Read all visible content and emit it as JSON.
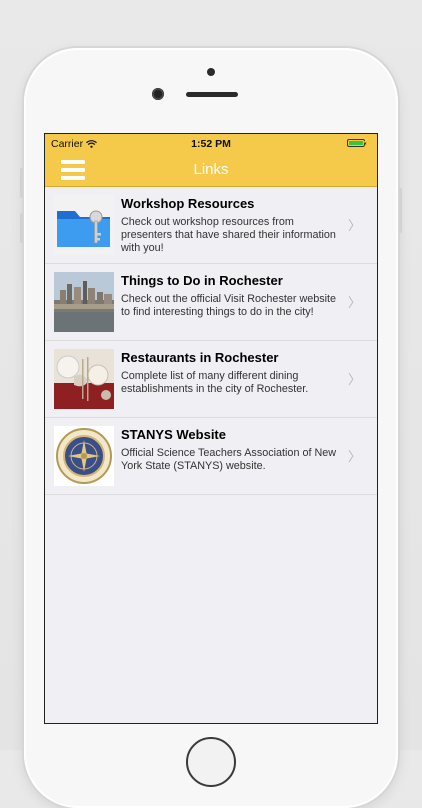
{
  "status_bar": {
    "carrier": "Carrier",
    "time": "1:52 PM",
    "battery_color": "#3bc43b"
  },
  "nav": {
    "title": "Links",
    "menu_icon": "hamburger-menu-icon",
    "bar_color": "#f5c94a"
  },
  "links": [
    {
      "title": "Workshop Resources",
      "description": "Check out workshop resources from presenters that have shared their information with you!",
      "thumbnail": "folder-key-icon"
    },
    {
      "title": "Things to Do in Rochester",
      "description": "Check out the official Visit Rochester website to find interesting things to do in the city!",
      "thumbnail": "rochester-skyline-photo"
    },
    {
      "title": "Restaurants in Rochester",
      "description": "Complete list of many different dining establishments in the city of Rochester.",
      "thumbnail": "dining-table-photo"
    },
    {
      "title": "STANYS Website",
      "description": "Official Science Teachers Association of New York State (STANYS) website.",
      "thumbnail": "stanys-seal-logo"
    }
  ],
  "chevron_glyph": "〉"
}
